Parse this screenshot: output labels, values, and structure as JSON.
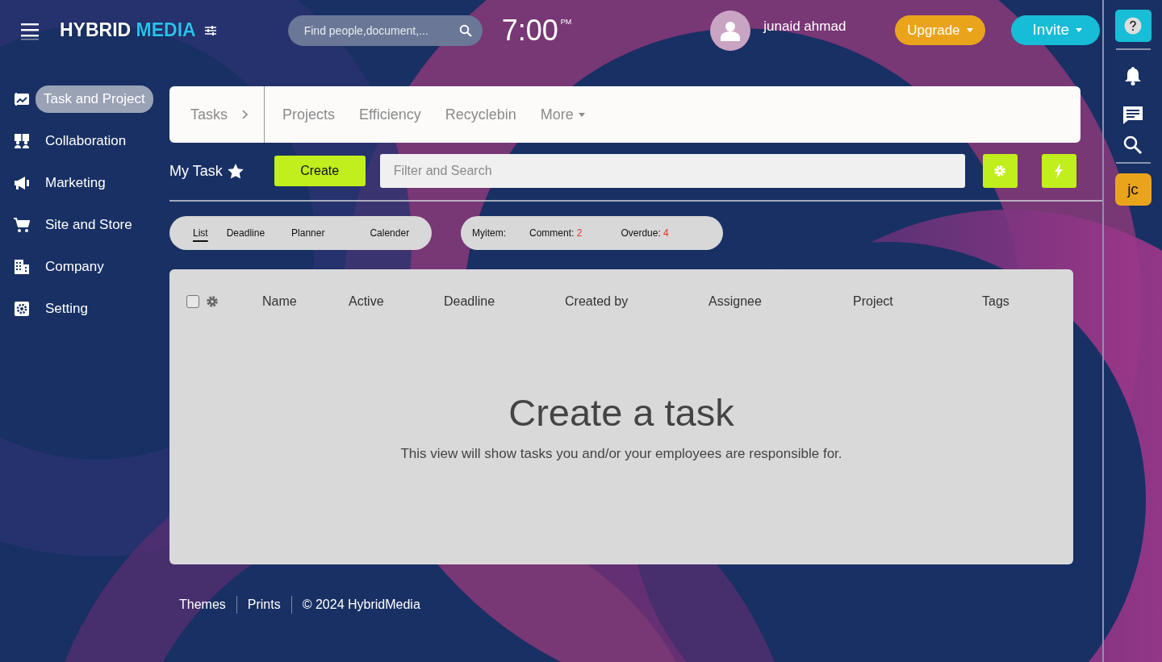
{
  "header": {
    "logo": {
      "part_1": "HYBRID",
      "part_2": "MEDIA"
    },
    "search": {
      "placeholder": "Find people,document,..."
    },
    "clock": {
      "time": "7:00",
      "period": "PM"
    },
    "user": {
      "name": "junaid ahmad"
    },
    "buttons": [
      {
        "label": "Upgrade",
        "kind": "warning"
      },
      {
        "label": "Invite",
        "kind": "info"
      }
    ]
  },
  "sidebar": {
    "items": [
      {
        "label": "Task and Project",
        "selected": true
      },
      {
        "label": "Collaboration",
        "selected": false
      },
      {
        "label": "Marketing",
        "selected": false
      },
      {
        "label": "Site and Store",
        "selected": false
      },
      {
        "label": "Company",
        "selected": false
      },
      {
        "label": "Setting",
        "selected": false
      }
    ]
  },
  "tabs": [
    {
      "label": "Tasks",
      "selected": true,
      "kind": "link"
    },
    {
      "label": "Projects",
      "selected": false,
      "kind": "link"
    },
    {
      "label": "Efficiency",
      "selected": false,
      "kind": "link"
    },
    {
      "label": "Recyclebin",
      "selected": false,
      "kind": "link"
    },
    {
      "label": "More",
      "selected": false,
      "kind": "dropdown"
    }
  ],
  "toolbar": {
    "title": "My Task",
    "starred": true,
    "create_button": "Create",
    "filter": {
      "placeholder": "Filter and Search"
    }
  },
  "views": [
    {
      "label": "List",
      "selected": true
    },
    {
      "label": "Deadline",
      "selected": false
    },
    {
      "label": "Planner",
      "selected": false
    },
    {
      "label": "Calender",
      "selected": false
    }
  ],
  "counters": [
    {
      "label": "Myitem:"
    },
    {
      "label": "Comment:",
      "value": "2"
    },
    {
      "label": "Overdue:",
      "value": "4"
    }
  ],
  "table": {
    "select_all_checked": false,
    "columns": [
      "Name",
      "Active",
      "Deadline",
      "Created by",
      "Assignee",
      "Project",
      "Tags"
    ]
  },
  "empty_state": {
    "title": "Create a task",
    "text": "This view will show tasks you and/or your employees are responsible for."
  },
  "footer": {
    "links": [
      "Themes",
      "Prints"
    ],
    "copyright": "© 2024 HybridMedia"
  },
  "rail": {
    "avatar_initials": "jc"
  }
}
